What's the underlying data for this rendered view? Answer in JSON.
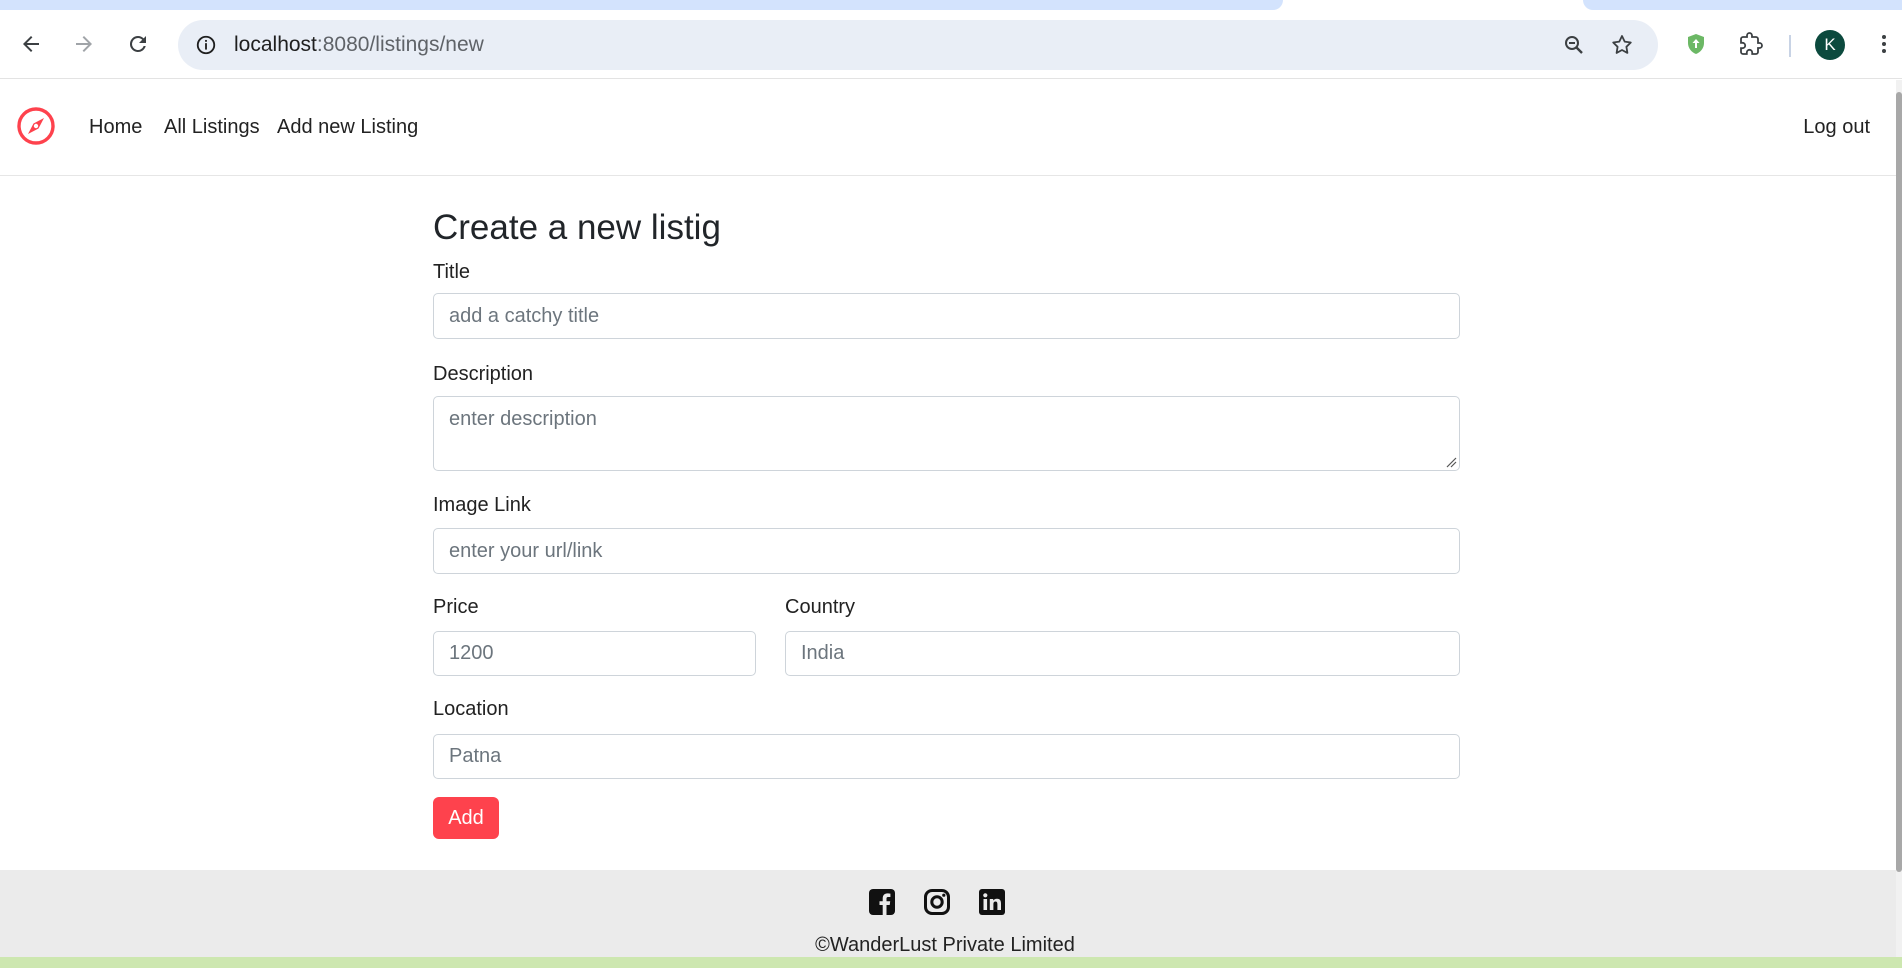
{
  "browser": {
    "url_host": "localhost",
    "url_rest": ":8080/listings/new",
    "profile_initial": "K",
    "icons": {
      "back": "back-arrow-icon",
      "forward": "forward-arrow-icon",
      "reload": "reload-icon",
      "site_info": "info-icon",
      "zoom": "zoom-icon",
      "bookmark": "star-icon",
      "extension_shield": "shield-icon",
      "extensions": "puzzle-icon",
      "menu": "kebab-menu-icon"
    }
  },
  "navbar": {
    "brand_icon": "compass-icon",
    "links": {
      "home": "Home",
      "all_listings": "All Listings",
      "add_listing": "Add new Listing",
      "logout": "Log out"
    }
  },
  "form": {
    "heading": "Create a new listig",
    "title_label": "Title",
    "title_placeholder": "add a catchy title",
    "description_label": "Description",
    "description_placeholder": "enter description",
    "image_label": "Image Link",
    "image_placeholder": "enter your url/link",
    "price_label": "Price",
    "price_placeholder": "1200",
    "country_label": "Country",
    "country_placeholder": "India",
    "location_label": "Location",
    "location_placeholder": "Patna",
    "submit_label": "Add"
  },
  "footer": {
    "social_icons": [
      "facebook-icon",
      "instagram-icon",
      "linkedin-icon"
    ],
    "copyright": "©WanderLust Private Limited"
  },
  "colors": {
    "brand": "#fe424d",
    "tab_blue": "#d3e3fd",
    "omnibox_bg": "#e9eef6",
    "footer_bg": "#ebebeb",
    "avatar_bg": "#0c4a3e"
  }
}
